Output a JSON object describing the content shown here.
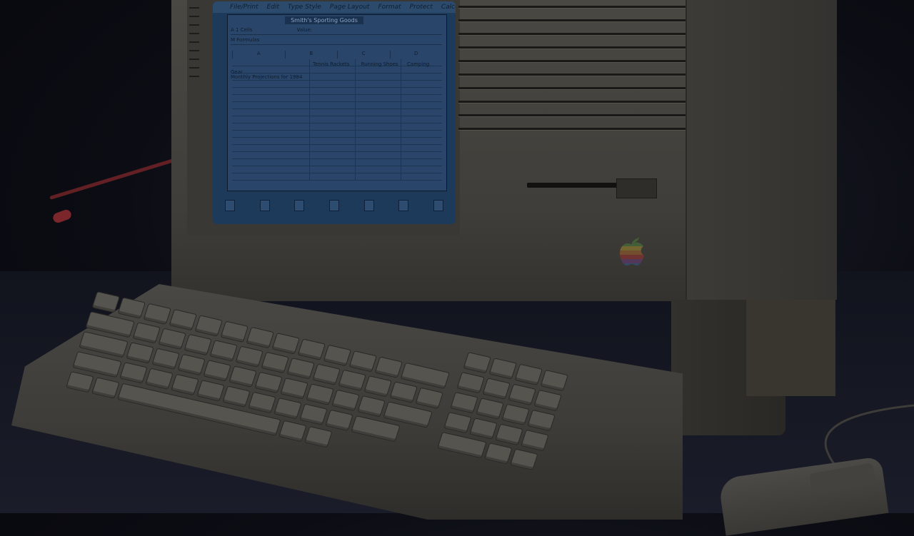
{
  "scene": {
    "description_hidden": false
  },
  "screen": {
    "menubar": [
      "File/Print",
      "Edit",
      "Type Style",
      "Page Layout",
      "Format",
      "Protect",
      "Calculate"
    ],
    "sheet_title": "Smith's Sporting Goods",
    "formula_label": "Value:",
    "row_label_1": "A 1 Cells",
    "row_label_2": "M Formulas",
    "col_headers": [
      "A",
      "B",
      "C",
      "D"
    ],
    "row_headers_text": [
      "Tennis Rackets",
      "Running Shoes",
      "Camping Gear"
    ],
    "row_title": "Monthly Projections for 1984"
  },
  "colors": {
    "background": "#0c0d14",
    "beige_dim": "#4a4843",
    "screen_blue": "#29466a"
  },
  "icons": [
    "apple-logo-icon",
    "trash-icon",
    "clipboard-icon",
    "calculator-icon"
  ]
}
